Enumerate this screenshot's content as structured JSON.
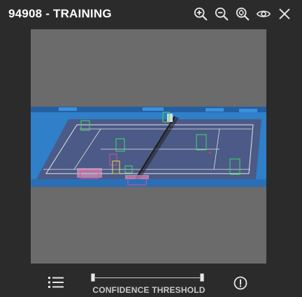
{
  "header": {
    "title": "94908 - TRAINING"
  },
  "toolbar": {
    "icons": [
      "zoom-in-icon",
      "zoom-out-icon",
      "zoom-fit-icon",
      "eye-icon",
      "close-icon"
    ]
  },
  "footer": {
    "threshold_label": "CONFIDENCE THRESHOLD",
    "threshold_range": [
      0,
      1
    ]
  },
  "colors": {
    "background": "#2b2b2b",
    "viewer": "#6b6b6b",
    "court": "#4b5a86",
    "surround": "#2f7fc9",
    "box_green": "#3ddc6a",
    "box_pink": "#e04ca0",
    "box_yellow": "#e4e04a"
  }
}
